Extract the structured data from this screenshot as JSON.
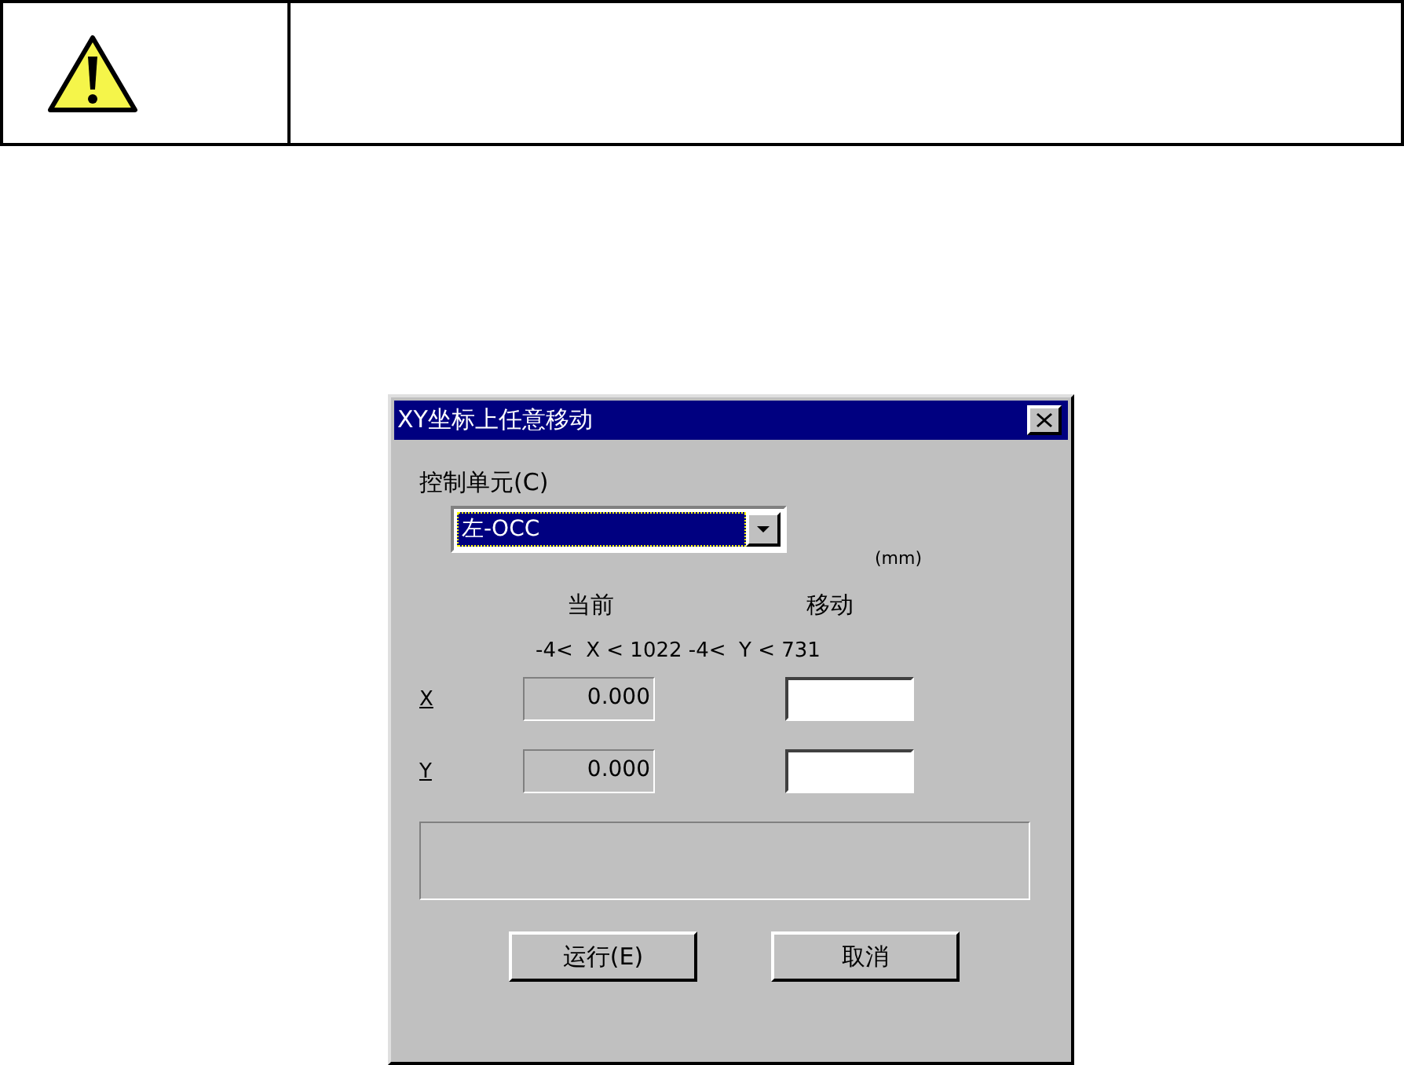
{
  "dialog": {
    "title": "XY坐标上任意移动",
    "control_unit": {
      "label": "控制单元(C)",
      "value": "左-OCC"
    },
    "unit": "(mm)",
    "headers": [
      "当前",
      "移动"
    ],
    "range": "-4<  X < 1022 -4<  Y < 731",
    "axes": [
      {
        "label": "X",
        "current": "0.000"
      },
      {
        "label": "Y",
        "current": "0.000"
      }
    ],
    "buttons": [
      "运行(E)",
      "取消"
    ]
  }
}
